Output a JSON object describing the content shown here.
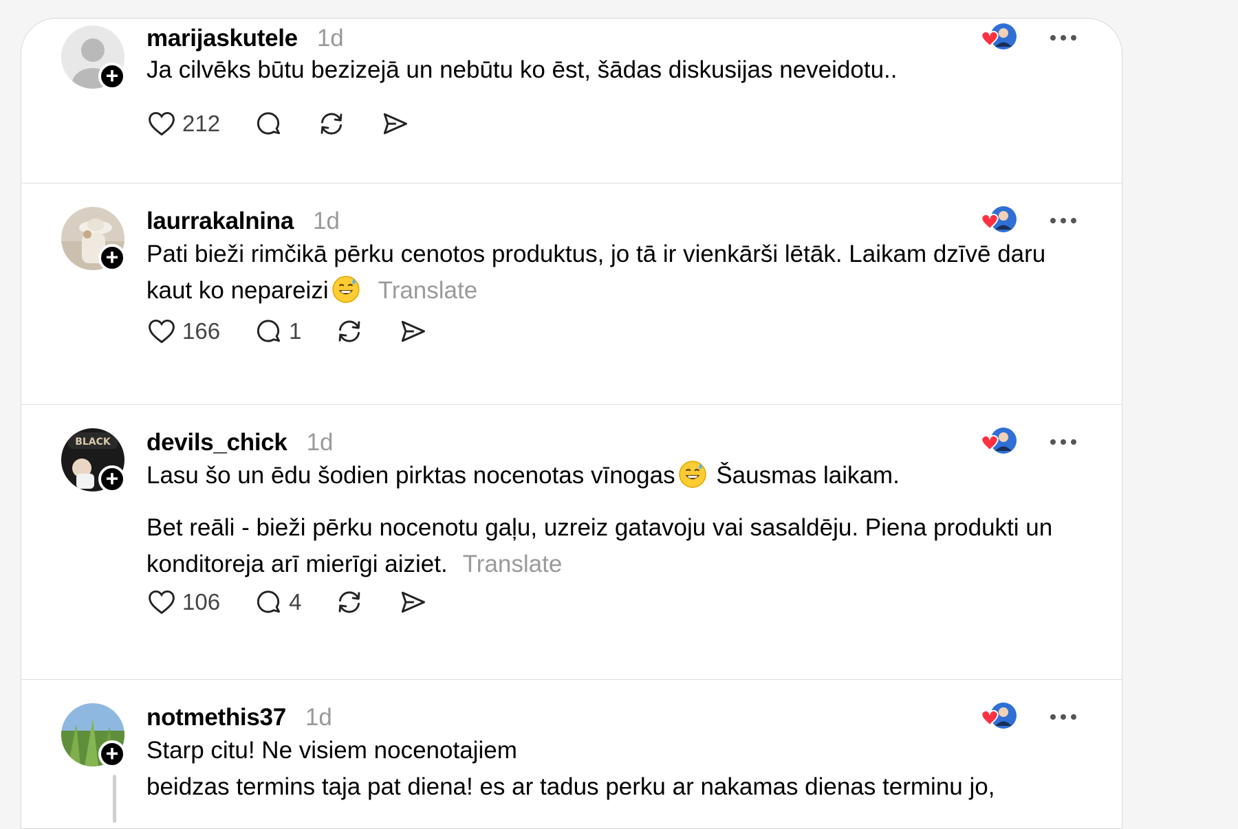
{
  "posts": [
    {
      "username": "marijaskutele",
      "time": "1d",
      "paragraphs": [
        "Ja cilvēks būtu bezizejā un nebūtu ko ēst, šādas diskusijas neveidotu.."
      ],
      "translate": "",
      "likes": "212",
      "replies": "",
      "avatar": "default-avatar"
    },
    {
      "username": "laurrakalnina",
      "time": "1d",
      "paragraphs": [
        "Pati bieži rimčikā pērku cenotos produktus, jo tā ir vienkārši lētāk. Laikam dzīvē daru kaut ko nepareizi"
      ],
      "translate": "Translate",
      "likes": "166",
      "replies": "1",
      "avatar": "photo-avatar"
    },
    {
      "username": "devils_chick",
      "time": "1d",
      "paragraphs": [
        "Lasu šo un ēdu šodien pirktas nocenotas vīnogas",
        "Šausmas laikam.",
        "Bet reāli - bieži pērku nocenotu gaļu, uzreiz gatavoju vai sasaldēju. Piena produkti un konditoreja arī mierīgi aiziet."
      ],
      "translate": "Translate",
      "likes": "106",
      "replies": "4",
      "avatar": "photo-avatar"
    },
    {
      "username": "notmethis37",
      "time": "1d",
      "paragraphs": [
        "Starp citu! Ne visiem nocenotajiem",
        "beidzas termins taja pat diena! es ar tadus perku ar nakamas dienas terminu jo,"
      ],
      "translate": "",
      "likes": "",
      "replies": "",
      "avatar": "photo-avatar"
    }
  ],
  "icons": {
    "like": "heart-icon",
    "reply": "comment-icon",
    "repost": "repost-icon",
    "share": "share-icon",
    "more": "more-icon",
    "follow": "plus-icon",
    "emoji": "grinning-sweat-emoji"
  },
  "colors": {
    "reaction_heart": "#ff3040",
    "muted_text": "#999999",
    "border": "#dedede"
  }
}
